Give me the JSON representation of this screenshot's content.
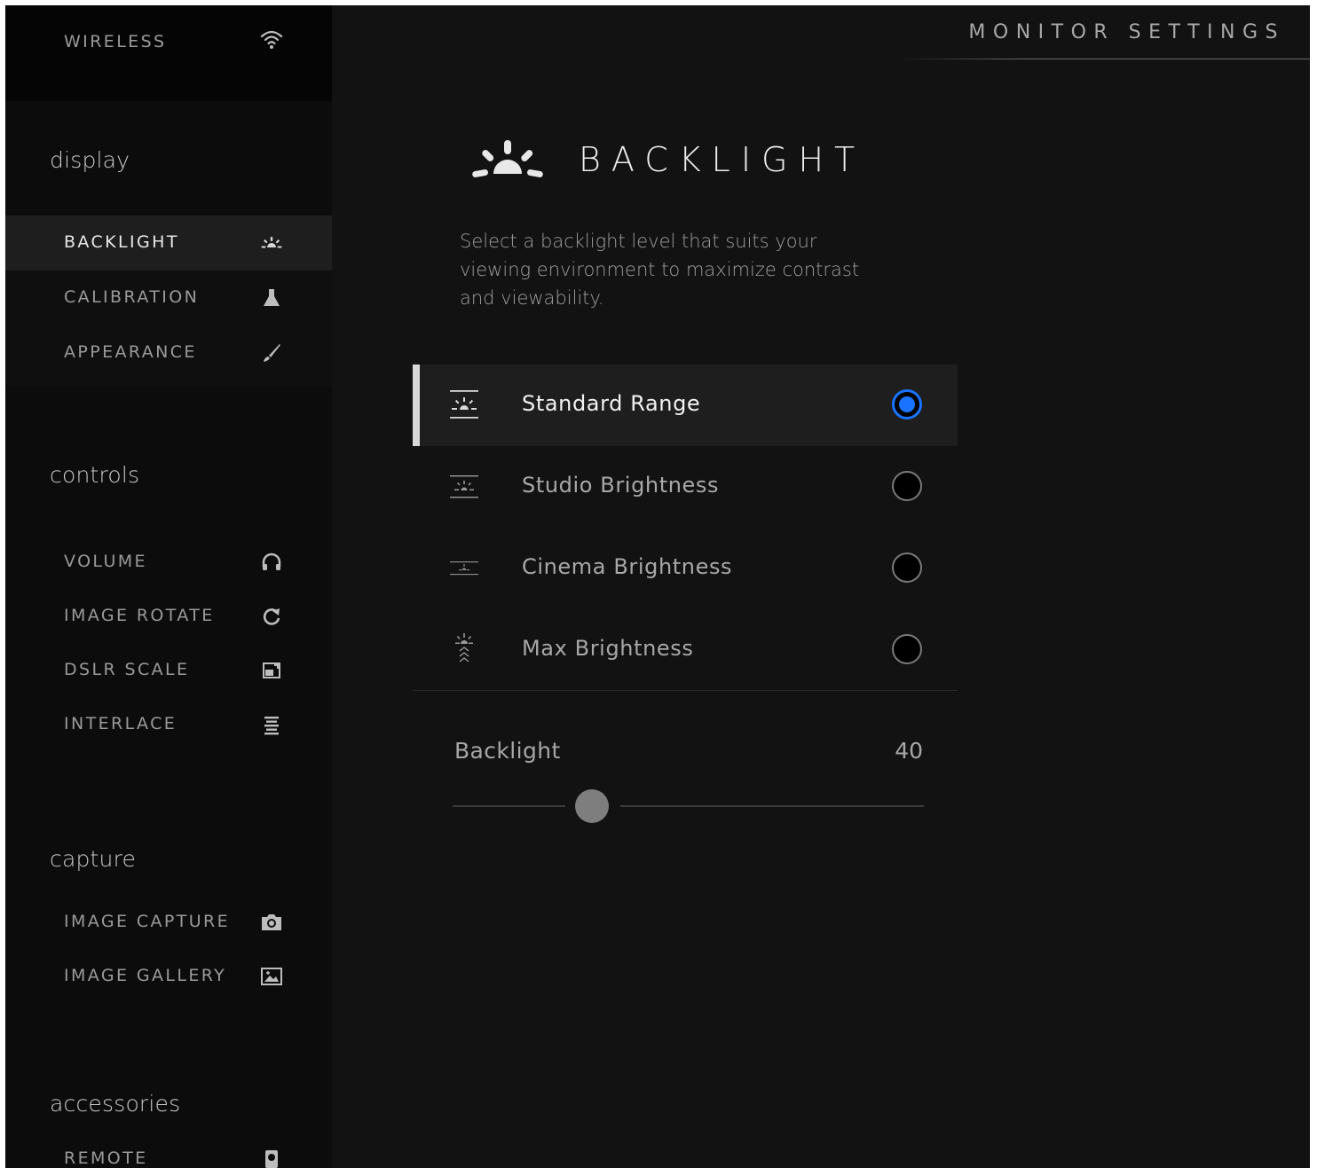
{
  "header": {
    "title": "MONITOR SETTINGS"
  },
  "sidebar": {
    "wireless": {
      "label": "WIRELESS",
      "icon": "wifi-icon"
    },
    "sections": {
      "display": {
        "title": "display",
        "items": [
          {
            "label": "BACKLIGHT",
            "icon": "backlight-icon",
            "active": true
          },
          {
            "label": "CALIBRATION",
            "icon": "calibration-probe-icon"
          },
          {
            "label": "APPEARANCE",
            "icon": "brush-icon"
          }
        ]
      },
      "controls": {
        "title": "controls",
        "items": [
          {
            "label": "VOLUME",
            "icon": "headphones-icon"
          },
          {
            "label": "IMAGE ROTATE",
            "icon": "rotate-icon"
          },
          {
            "label": "DSLR SCALE",
            "icon": "dslr-scale-icon"
          },
          {
            "label": "INTERLACE",
            "icon": "interlace-icon"
          }
        ]
      },
      "capture": {
        "title": "capture",
        "items": [
          {
            "label": "IMAGE CAPTURE",
            "icon": "camera-icon"
          },
          {
            "label": "IMAGE GALLERY",
            "icon": "gallery-icon"
          }
        ]
      },
      "accessories": {
        "title": "accessories",
        "items": [
          {
            "label": "REMOTE",
            "icon": "remote-icon"
          }
        ]
      }
    }
  },
  "main": {
    "title": "BACKLIGHT",
    "icon": "backlight-icon",
    "description": "Select a backlight level that suits your viewing environment to maximize contrast and viewability.",
    "options": [
      {
        "label": "Standard Range",
        "icon": "standard-range-icon",
        "selected": true
      },
      {
        "label": "Studio Brightness",
        "icon": "studio-brightness-icon",
        "selected": false
      },
      {
        "label": "Cinema Brightness",
        "icon": "cinema-brightness-icon",
        "selected": false
      },
      {
        "label": "Max Brightness",
        "icon": "max-brightness-icon",
        "selected": false
      }
    ],
    "slider": {
      "label": "Backlight",
      "value": "40",
      "fraction": 0.3
    },
    "accent_color": "#1a73ff"
  }
}
